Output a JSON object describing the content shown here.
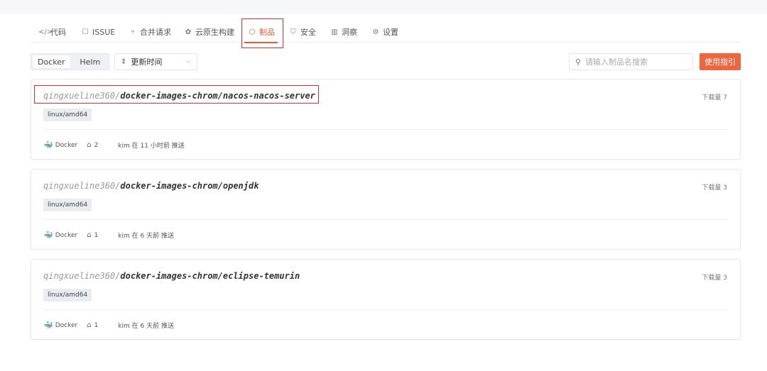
{
  "tabs": [
    {
      "icon": "code-icon",
      "glyph": "</>",
      "label": "代码"
    },
    {
      "icon": "issue-icon",
      "glyph": "☐",
      "label": "ISSUE"
    },
    {
      "icon": "merge-icon",
      "glyph": "⑂",
      "label": "合并请求"
    },
    {
      "icon": "cloud-native-icon",
      "glyph": "✿",
      "label": "云原生构建"
    },
    {
      "icon": "package-icon",
      "glyph": "⬡",
      "label": "制品",
      "active": true
    },
    {
      "icon": "shield-icon",
      "glyph": "⛉",
      "label": "安全"
    },
    {
      "icon": "insight-icon",
      "glyph": "▥",
      "label": "洞察"
    },
    {
      "icon": "gear-icon",
      "glyph": "⚙",
      "label": "设置"
    }
  ],
  "filters": {
    "types": [
      "Docker",
      "Helm"
    ],
    "active_type": "Docker",
    "sort_label": "更新时间",
    "search_placeholder": "请输入制品名搜索",
    "guide_label": "使用指引"
  },
  "packages": [
    {
      "owner": "qingxueline360/",
      "repo": "docker-images-chrom/nacos-nacos-server",
      "downloads": "下载量 7",
      "platform": "linux/amd64",
      "type": "Docker",
      "tag_count": "2",
      "pushed": "kim 在 11 小时前 推送"
    },
    {
      "owner": "qingxueline360/",
      "repo": "docker-images-chrom/openjdk",
      "downloads": "下载量 3",
      "platform": "linux/amd64",
      "type": "Docker",
      "tag_count": "1",
      "pushed": "kim 在 6 天前 推送"
    },
    {
      "owner": "qingxueline360/",
      "repo": "docker-images-chrom/eclipse-temurin",
      "downloads": "下载量 3",
      "platform": "linux/amd64",
      "type": "Docker",
      "tag_count": "1",
      "pushed": "kim 在 6 天前 推送"
    }
  ],
  "colors": {
    "accent": "#e9582e",
    "button": "#f0643e",
    "highlight_box": "#d9302b",
    "docker_blue": "#2f86d8"
  }
}
